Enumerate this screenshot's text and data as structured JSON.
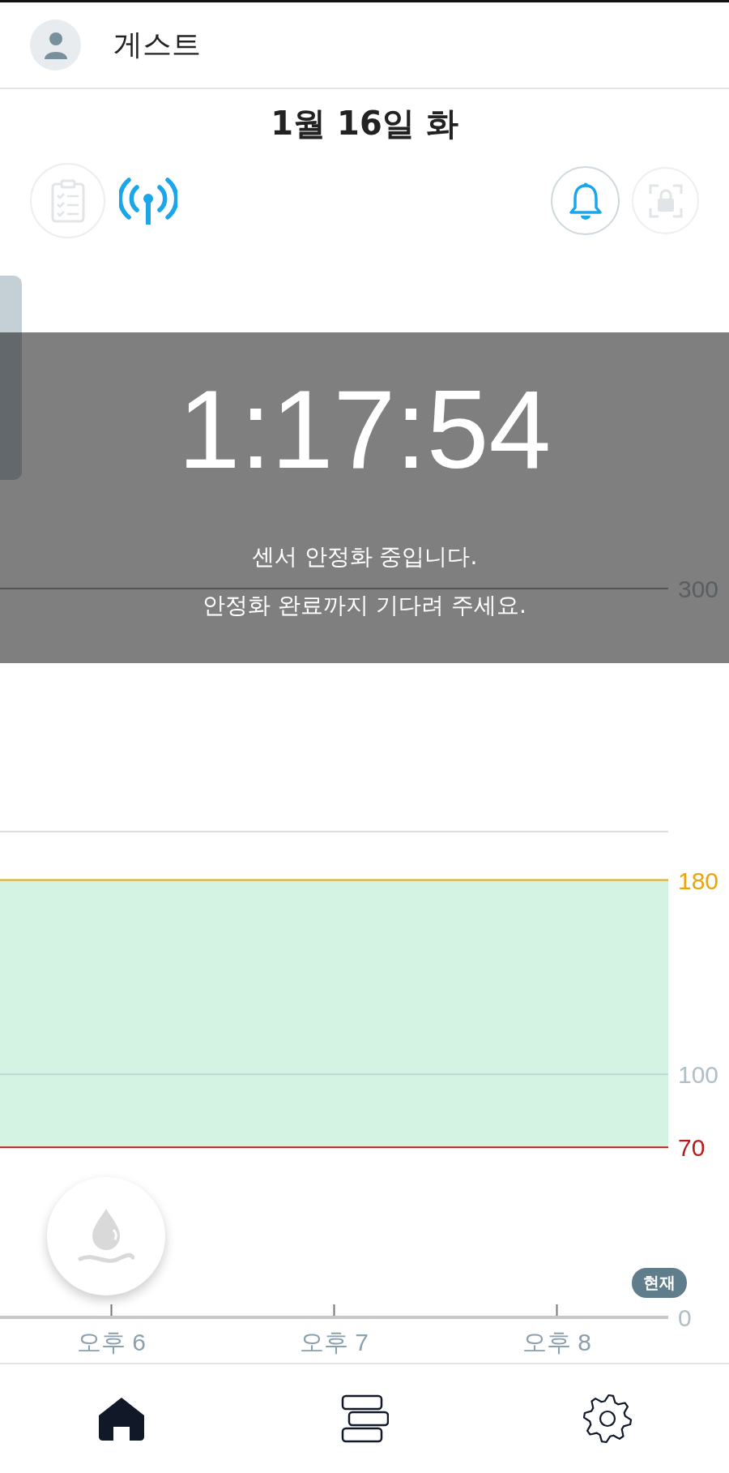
{
  "header": {
    "user_name": "게스트"
  },
  "date": "1월 16일 화",
  "status_icons": [
    {
      "kind": "clipboard",
      "disabled": true
    },
    {
      "kind": "signal",
      "disabled": false
    },
    {
      "kind": "bell",
      "disabled": false
    },
    {
      "kind": "lock",
      "disabled": true
    }
  ],
  "overlay": {
    "timer": "1:17:54",
    "message_lines": [
      "센서 안정화 중입니다.",
      "안정화 완료까지 기다려 주세요."
    ]
  },
  "chart_data": {
    "type": "line",
    "ylim": [
      0,
      300
    ],
    "yticks": [
      0,
      70,
      100,
      180,
      300
    ],
    "categories": [
      "오후 6",
      "오후 7",
      "오후 8"
    ],
    "bands": [
      {
        "axis": "y",
        "from": 70,
        "to": 180,
        "color": "#d5f3e3"
      }
    ],
    "ref_lines": [
      {
        "axis": "y",
        "value": 200,
        "color": "#dcdcdc"
      },
      {
        "axis": "y",
        "value": 180,
        "color": "#e8a50c"
      },
      {
        "axis": "y",
        "value": 100,
        "color": "#b9ddd6"
      },
      {
        "axis": "y",
        "value": 70,
        "color": "#b71c1c"
      }
    ]
  },
  "now_badge": "현재",
  "nav": [
    {
      "kind": "home",
      "selected": true
    },
    {
      "kind": "list",
      "selected": false
    },
    {
      "kind": "settings",
      "selected": false
    }
  ]
}
